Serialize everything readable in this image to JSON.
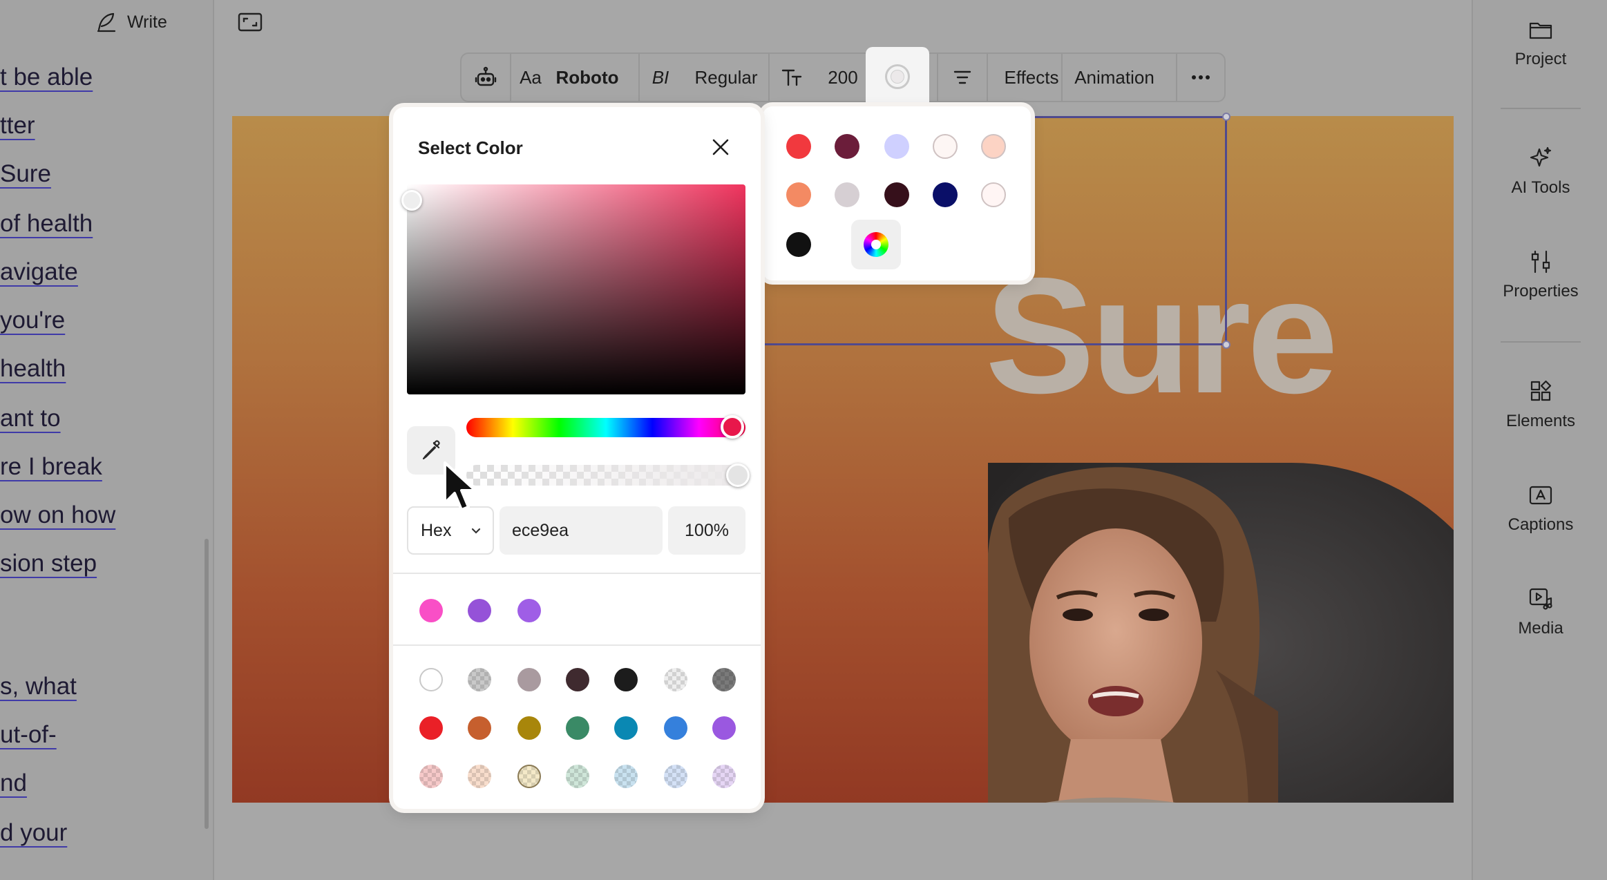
{
  "header": {
    "write_label": "Write"
  },
  "transcript": {
    "lines": [
      "t be able",
      "tter",
      "Sure",
      "of health",
      "avigate",
      "you're",
      " health",
      "ant to",
      "re I break",
      "ow on how",
      "sion step",
      "s, what",
      "ut-of-",
      "nd",
      "d your"
    ]
  },
  "toolbar": {
    "font_size_icon_label": "Aa",
    "font_family": "Roboto",
    "style_icon_label": "BI",
    "font_weight": "Regular",
    "size_value": "200",
    "effects_label": "Effects",
    "animation_label": "Animation"
  },
  "canvas": {
    "title_text": "Sure",
    "background_top": "#b88c4a",
    "background_bottom": "#923923"
  },
  "sidebar": {
    "items": [
      {
        "label": "Project",
        "icon": "folder-icon"
      },
      {
        "label": "AI Tools",
        "icon": "sparkle-icon"
      },
      {
        "label": "Properties",
        "icon": "sliders-icon"
      },
      {
        "label": "Elements",
        "icon": "shapes-icon"
      },
      {
        "label": "Captions",
        "icon": "caption-icon"
      },
      {
        "label": "Media",
        "icon": "media-icon"
      }
    ]
  },
  "color_picker": {
    "title": "Select Color",
    "format": "Hex",
    "hex_value": "ece9ea",
    "opacity": "100%",
    "hue_color": "#f0345e",
    "recent_colors": [
      "#f94fc6",
      "#9552d8",
      "#9f5ee6"
    ],
    "palette": [
      [
        "#ffffff",
        "checker-gray",
        "#a99a9f",
        "#3f2a2f",
        "#1c1c1c",
        "checker-light",
        "checker-dark"
      ],
      [
        "#ea2027",
        "#c65f2e",
        "#a8860b",
        "#3a8a66",
        "#0a88b3",
        "#3580dc",
        "#9a58e0"
      ],
      [
        "checker-red",
        "checker-peach",
        "checker-yellow",
        "checker-green",
        "checker-blue",
        "checker-periwinkle",
        "checker-lilac"
      ]
    ]
  },
  "quick_colors": {
    "swatches": [
      "#f1393e",
      "#6b1d3a",
      "#cfd0ff",
      "#fdf6f4",
      "#fcd3c4",
      "#f38a63",
      "#d6cfd3",
      "#36101b",
      "#0a0f68",
      "#fff5f4",
      "#111111"
    ]
  }
}
